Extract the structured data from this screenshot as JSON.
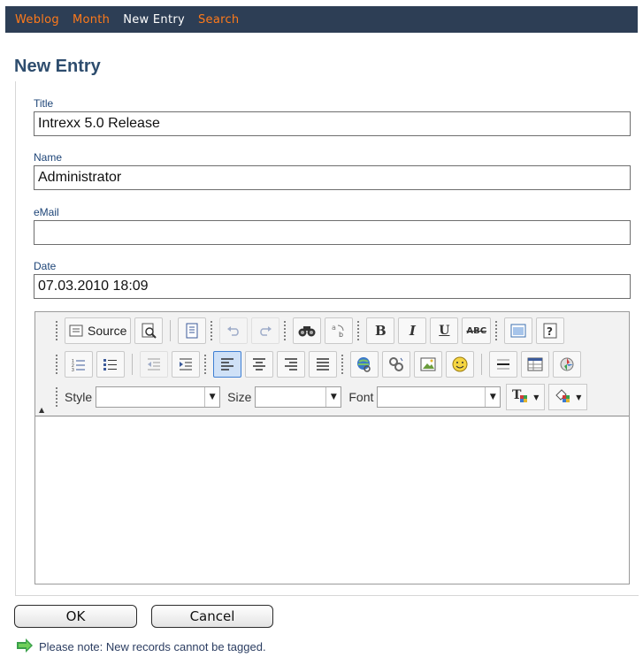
{
  "nav": {
    "items": [
      {
        "label": "Weblog"
      },
      {
        "label": "Month"
      },
      {
        "label": "New Entry"
      },
      {
        "label": "Search"
      }
    ],
    "active_index": 2,
    "colors": {
      "bar": "#2d3e55",
      "link": "#ff7a1a",
      "active": "#ffffff"
    }
  },
  "page": {
    "title": "New Entry"
  },
  "form": {
    "title": {
      "label": "Title",
      "value": "Intrexx 5.0 Release"
    },
    "name": {
      "label": "Name",
      "value": "Administrator"
    },
    "email": {
      "label": "eMail",
      "value": ""
    },
    "date": {
      "label": "Date",
      "value": "07.03.2010 18:09"
    }
  },
  "editor": {
    "source_label": "Source",
    "style_label": "Style",
    "size_label": "Size",
    "font_label": "Font",
    "style_value": "",
    "size_value": "",
    "font_value": "",
    "icons": {
      "row1": [
        "source-icon",
        "preview-icon",
        "templates-icon",
        "undo-icon",
        "redo-icon",
        "find-icon",
        "replace-icon",
        "bold-icon",
        "italic-icon",
        "underline-icon",
        "strikethrough-icon",
        "maximize-icon",
        "help-icon"
      ],
      "row2": [
        "numbered-list-icon",
        "bulleted-list-icon",
        "outdent-icon",
        "indent-icon",
        "align-left-icon",
        "align-center-icon",
        "align-right-icon",
        "justify-icon",
        "link-icon",
        "unlink-icon",
        "image-icon",
        "smiley-icon",
        "horizontal-rule-icon",
        "table-icon",
        "special-char-icon"
      ],
      "row3": [
        "text-color-icon",
        "background-color-icon"
      ]
    },
    "body": ""
  },
  "actions": {
    "ok_label": "OK",
    "cancel_label": "Cancel"
  },
  "note": {
    "text": "Please note: New records cannot be tagged.",
    "icon": "green-arrow-icon"
  }
}
